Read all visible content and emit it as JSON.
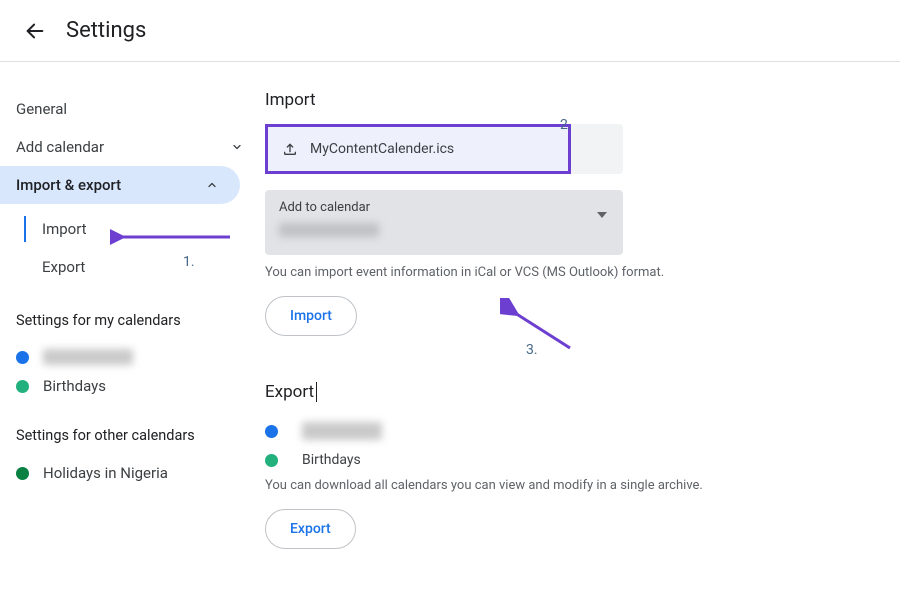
{
  "header": {
    "title": "Settings"
  },
  "sidebar": {
    "general": "General",
    "add_calendar": "Add calendar",
    "import_export": "Import & export",
    "sub": {
      "import": "Import",
      "export": "Export"
    },
    "my_cal_header": "Settings for my calendars",
    "my_cals": [
      {
        "name": "",
        "color": "#1a73e8",
        "redacted": true
      },
      {
        "name": "Birthdays",
        "color": "#0b8043",
        "redacted": false
      }
    ],
    "other_cal_header": "Settings for other calendars",
    "other_cals": [
      {
        "name": "Holidays in Nigeria",
        "color": "#0b8043"
      }
    ]
  },
  "import": {
    "title": "Import",
    "file_name": "MyContentCalender.ics",
    "add_to_label": "Add to calendar",
    "hint": "You can import event information in iCal or VCS (MS Outlook) format.",
    "button": "Import"
  },
  "export": {
    "title": "Export",
    "cals": [
      {
        "name": "",
        "color": "#1a73e8",
        "redacted": true
      },
      {
        "name": "Birthdays",
        "color": "#0b8043",
        "redacted": false
      }
    ],
    "hint": "You can download all calendars you can view and modify in a single archive.",
    "button": "Export"
  },
  "annotations": {
    "one": "1.",
    "two": "2.",
    "three": "3."
  }
}
